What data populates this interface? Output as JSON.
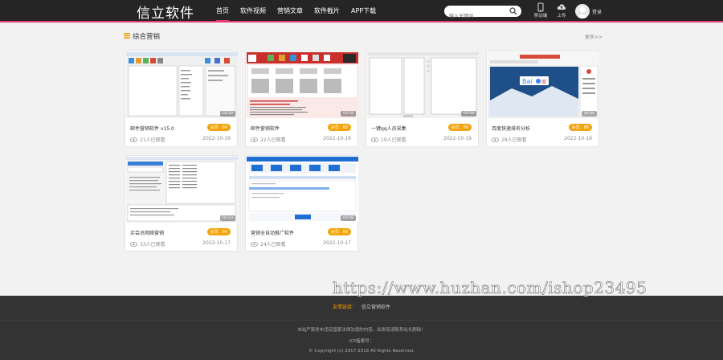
{
  "header": {
    "logo": "信立软件",
    "nav": [
      "首页",
      "软件视频",
      "营销文章",
      "软件截片",
      "APP下载"
    ],
    "search_placeholder": "输入关键词...",
    "mobile_label": "移动端",
    "upload_label": "上传",
    "login_label": "登录"
  },
  "section": {
    "title": "综合营销",
    "more": "更多>>"
  },
  "cards": [
    {
      "title": "邮件营销软件 v15.0",
      "price": "会员：88",
      "views": "21人已观看",
      "date": "2022-10-19",
      "duration": "02:10"
    },
    {
      "title": "邮件营销软件",
      "price": "会员：88",
      "views": "22人已观看",
      "date": "2022-10-19",
      "duration": "03:58"
    },
    {
      "title": "一键qq人员采集",
      "price": "会员：88",
      "views": "19人已观看",
      "date": "2022-10-19",
      "duration": "03:28"
    },
    {
      "title": "百度快速排名分析",
      "price": "会员：88",
      "views": "29人已观看",
      "date": "2022-10-19",
      "duration": "04:08"
    },
    {
      "title": "买会员网络营销",
      "price": "会员：88",
      "views": "33人已观看",
      "date": "2022-10-17",
      "duration": "02:13"
    },
    {
      "title": "营销全自动推广软件",
      "price": "会员：88",
      "views": "24人已观看",
      "date": "2022-10-17",
      "duration": "00:48"
    }
  ],
  "watermark": "https://www.huzhan.com/ishop23495",
  "footer": {
    "friend_label": "友情链接：",
    "friend_link": "信立营销软件",
    "notice": "本站严禁发布违反国家法律法规的内容，如发现请联系站长删除！",
    "icp": "ICP备案号：",
    "copyright": "© Copyright (c) 2017-2018 All Rights Reserved."
  },
  "colors": {
    "accent": "#e5397a",
    "price": "#f4a30a",
    "friend": "#f39800",
    "header_bg": "#252525",
    "footer_bg": "#333333"
  }
}
